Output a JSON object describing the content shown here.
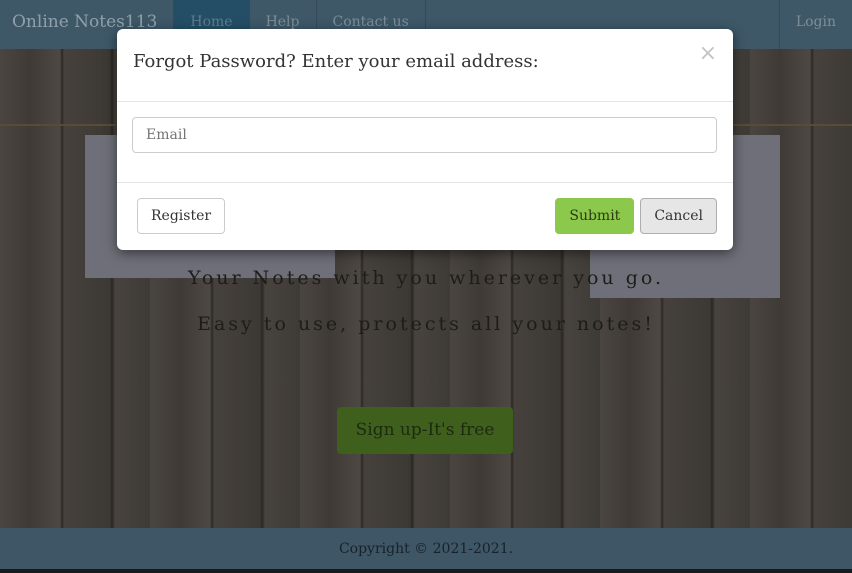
{
  "nav": {
    "brand": "Online Notes113",
    "items": [
      "Home",
      "Help",
      "Contact us"
    ],
    "login": "Login"
  },
  "hero": {
    "line1": "Your Notes with you wherever you go.",
    "line2": "Easy to use, protects all your notes!",
    "signup": "Sign up-It's free"
  },
  "footer": {
    "copyright": "Copyright © 2021-2021."
  },
  "modal": {
    "title": "Forgot Password? Enter your email address:",
    "close": "×",
    "email_placeholder": "Email",
    "register": "Register",
    "submit": "Submit",
    "cancel": "Cancel"
  }
}
